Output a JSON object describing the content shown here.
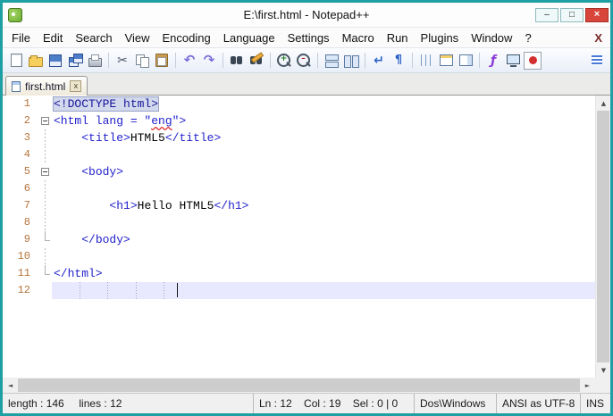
{
  "colors": {
    "window_border": "#1d9fa4",
    "tag_text": "#2222cc",
    "plain_text": "#000000",
    "line_number": "#b5743c",
    "current_line_bg": "#e8e8ff",
    "doctype_highlight_bg": "#d3d9ec",
    "misspell_underline": "#e03030",
    "close_button_bg": "#d8453a"
  },
  "titlebar": {
    "title": "E:\\first.html - Notepad++",
    "buttons": [
      {
        "name": "minimize-button",
        "glyph": "–"
      },
      {
        "name": "maximize-button",
        "glyph": "□"
      },
      {
        "name": "close-button",
        "glyph": "×"
      }
    ]
  },
  "menubar": {
    "items": [
      "File",
      "Edit",
      "Search",
      "View",
      "Encoding",
      "Language",
      "Settings",
      "Macro",
      "Run",
      "Plugins",
      "Window",
      "?"
    ],
    "close_doc": "X"
  },
  "toolbar": {
    "icons": [
      "new-file",
      "open-folder",
      "save",
      "save-all",
      "print",
      "|",
      "cut",
      "copy",
      "paste",
      "|",
      "undo",
      "redo",
      "|",
      "find",
      "replace",
      "|",
      "zoom-in",
      "zoom-out",
      "|",
      "sync-v",
      "sync-h",
      "|",
      "word-wrap",
      "show-all-chars",
      "|",
      "indent-guide",
      "user-dialog",
      "doc-map",
      "|",
      "function-list",
      "monitor",
      "record-macro",
      "->",
      "doc-switcher"
    ]
  },
  "tabbar": {
    "close_glyph": "x",
    "tabs": [
      {
        "label": "first.html",
        "active": true
      }
    ]
  },
  "editor": {
    "lines": [
      {
        "num": "1",
        "fold": "",
        "tokens": [
          {
            "t": "<!DOCTYPE html>",
            "c": "doctype"
          }
        ]
      },
      {
        "num": "2",
        "fold": "open",
        "tokens": [
          {
            "t": "<html lang = \"",
            "c": "tag"
          },
          {
            "t": "eng",
            "c": "tag misspell"
          },
          {
            "t": "\">",
            "c": "tag"
          }
        ]
      },
      {
        "num": "3",
        "fold": "line",
        "tokens": [
          {
            "t": "    ",
            "c": "text"
          },
          {
            "t": "<title>",
            "c": "tag"
          },
          {
            "t": "HTML5",
            "c": "text"
          },
          {
            "t": "</title>",
            "c": "tag"
          }
        ]
      },
      {
        "num": "4",
        "fold": "line",
        "tokens": []
      },
      {
        "num": "5",
        "fold": "open",
        "tokens": [
          {
            "t": "    ",
            "c": "text"
          },
          {
            "t": "<body>",
            "c": "tag"
          }
        ]
      },
      {
        "num": "6",
        "fold": "line",
        "tokens": []
      },
      {
        "num": "7",
        "fold": "line",
        "tokens": [
          {
            "t": "        ",
            "c": "text"
          },
          {
            "t": "<h1>",
            "c": "tag"
          },
          {
            "t": "Hello HTML5",
            "c": "text"
          },
          {
            "t": "</h1>",
            "c": "tag"
          }
        ]
      },
      {
        "num": "8",
        "fold": "line",
        "tokens": []
      },
      {
        "num": "9",
        "fold": "end",
        "tokens": [
          {
            "t": "    ",
            "c": "text"
          },
          {
            "t": "</body>",
            "c": "tag"
          }
        ]
      },
      {
        "num": "10",
        "fold": "line",
        "tokens": []
      },
      {
        "num": "11",
        "fold": "end",
        "tokens": [
          {
            "t": "</html>",
            "c": "tag"
          }
        ]
      },
      {
        "num": "12",
        "fold": "",
        "current": true,
        "guides": [
          4,
          8,
          12,
          16
        ],
        "caret_col": 18,
        "tokens": []
      }
    ]
  },
  "scrollbars": {
    "up": "▲",
    "down": "▼",
    "left": "◄",
    "right": "►"
  },
  "statusbar": {
    "doc_stats": "length : 146     lines : 12",
    "cursor": "Ln : 12    Col : 19    Sel : 0 | 0",
    "eol_format": "Dos\\Windows",
    "encoding": "ANSI as UTF-8",
    "insert_mode": "INS"
  }
}
